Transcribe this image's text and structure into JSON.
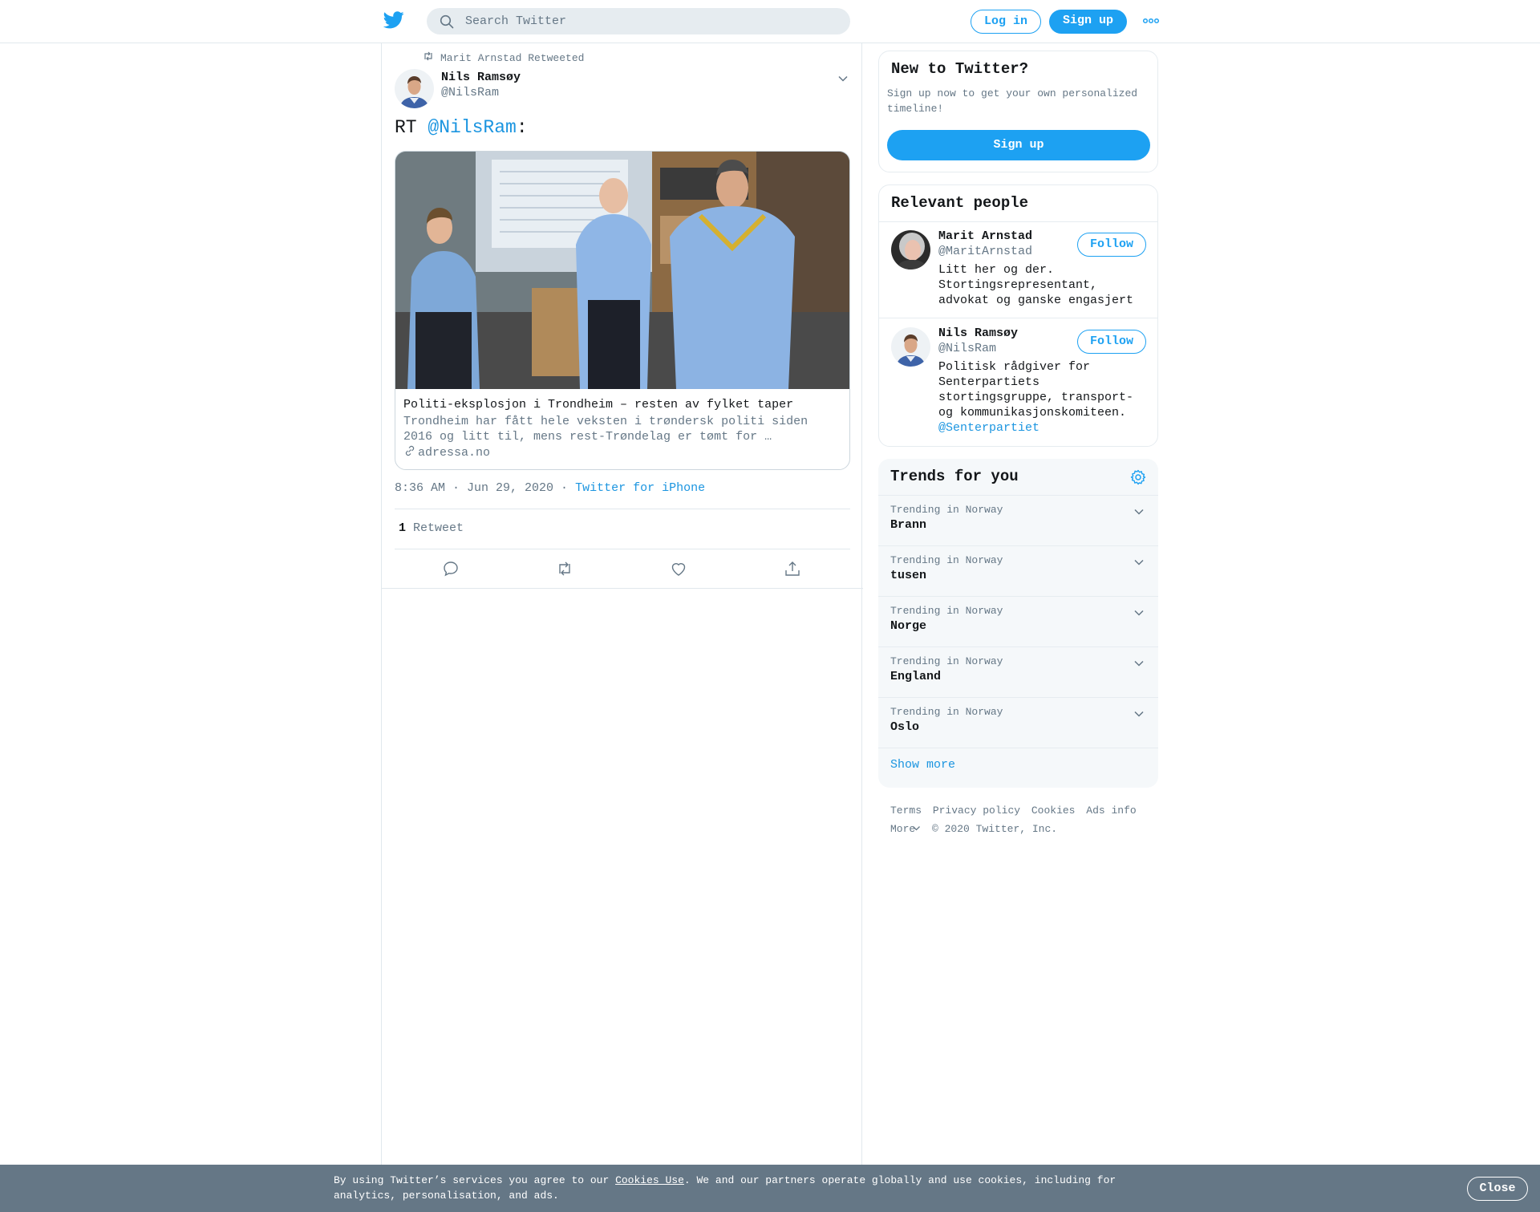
{
  "header": {
    "search_placeholder": "Search Twitter",
    "login_label": "Log in",
    "signup_label": "Sign up"
  },
  "tweet": {
    "retweeted_by": "Marit Arnstad Retweeted",
    "author_name": "Nils Ramsøy",
    "author_handle": "@NilsRam",
    "text_prefix": "RT ",
    "text_mention": "@NilsRam",
    "text_suffix": ":",
    "card": {
      "title": "Politi-eksplosjon i Trondheim – resten av fylket taper",
      "description": "Trondheim har fått hele veksten i trøndersk politi siden 2016 og litt til, mens rest-Trøndelag er tømt for …",
      "domain": "adressa.no"
    },
    "timestamp": "8:36 AM · Jun 29, 2020",
    "separator": " · ",
    "source": "Twitter for iPhone",
    "retweet_count": "1",
    "retweet_label": "Retweet"
  },
  "new_to_twitter": {
    "title": "New to Twitter?",
    "subtitle": "Sign up now to get your own personalized timeline!",
    "signup_label": "Sign up"
  },
  "relevant_people": {
    "title": "Relevant people",
    "people": [
      {
        "name": "Marit Arnstad",
        "handle": "@MaritArnstad",
        "bio": "Litt her og der. Stortingsrepresentant, advokat og ganske engasjert",
        "bio_link": "",
        "follow_label": "Follow"
      },
      {
        "name": "Nils Ramsøy",
        "handle": "@NilsRam",
        "bio": "Politisk rådgiver for Senterpartiets stortingsgruppe, transport- og kommunikasjonskomiteen.",
        "bio_link": "@Senterpartiet",
        "follow_label": "Follow"
      }
    ]
  },
  "trends": {
    "title": "Trends for you",
    "items": [
      {
        "context": "Trending in Norway",
        "name": "Brann"
      },
      {
        "context": "Trending in Norway",
        "name": "tusen"
      },
      {
        "context": "Trending in Norway",
        "name": "Norge"
      },
      {
        "context": "Trending in Norway",
        "name": "England"
      },
      {
        "context": "Trending in Norway",
        "name": "Oslo"
      }
    ],
    "show_more": "Show more"
  },
  "footer": {
    "links": [
      "Terms",
      "Privacy policy",
      "Cookies",
      "Ads info"
    ],
    "more": "More",
    "copyright": "© 2020 Twitter, Inc."
  },
  "cookie_bar": {
    "text_before": "By using Twitter’s services you agree to our ",
    "link": "Cookies Use",
    "text_after": ". We and our partners operate globally and use cookies, including for analytics, personalisation, and ads.",
    "close_label": "Close"
  },
  "colors": {
    "brand": "#1da1f2",
    "link": "#1b95e0",
    "secondary_text": "#657786",
    "cookie_bar_bg": "#657786"
  },
  "icons": {
    "logo": "twitter-bird-icon",
    "search": "search-icon",
    "more": "more-dots-icon",
    "retweet_context": "retweet-icon",
    "caret": "chevron-down-icon",
    "link": "link-icon",
    "reply": "reply-icon",
    "retweet": "retweet-icon",
    "like": "heart-icon",
    "share": "share-icon",
    "settings": "gear-icon"
  }
}
